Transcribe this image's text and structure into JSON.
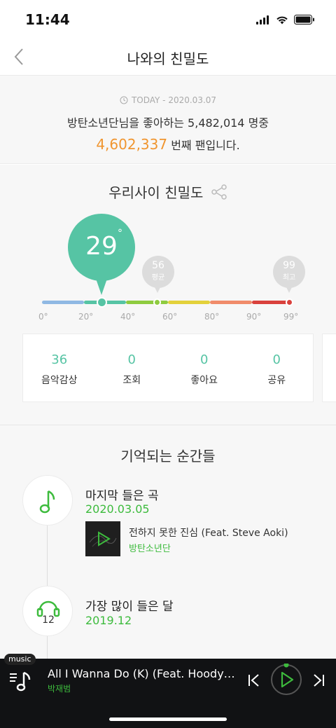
{
  "status_bar": {
    "time": "11:44"
  },
  "nav": {
    "title": "나와의 친밀도"
  },
  "summary": {
    "today_label": "TODAY - 2020.03.07",
    "fan_line": "방탄소년단님을 좋아하는 5,482,014 명중",
    "fan_rank": "4,602,337",
    "fan_suffix": " 번째 팬입니다."
  },
  "intimacy": {
    "title": "우리사이 친밀도",
    "my_value": "29",
    "degree_symbol": "°",
    "average_value": "56",
    "average_label": "평균",
    "max_value": "99",
    "max_label": "최고",
    "ticks": [
      "0°",
      "20°",
      "40°",
      "60°",
      "80°",
      "90°",
      "99°"
    ],
    "colors": [
      "#8fb8e3",
      "#56c4a4",
      "#8ecb3f",
      "#e3d13b",
      "#f08b6a",
      "#d9413c"
    ]
  },
  "stats": [
    {
      "value": "36",
      "label": "음악감상"
    },
    {
      "value": "0",
      "label": "조회"
    },
    {
      "value": "0",
      "label": "좋아요"
    },
    {
      "value": "0",
      "label": "공유"
    }
  ],
  "moments": {
    "title": "기억되는 순간들",
    "last_song": {
      "title": "마지막 들은 곡",
      "date": "2020.03.05",
      "song_title": "전하지 못한 진심 (Feat. Steve Aoki)",
      "artist": "방탄소년단"
    },
    "top_month": {
      "title": "가장 많이 들은 달",
      "date": "2019.12",
      "count": "12"
    }
  },
  "player": {
    "tag": "music",
    "title": "All I Wanna Do (K) (Feat. Hoody, Loco)",
    "artist": "박재범"
  }
}
